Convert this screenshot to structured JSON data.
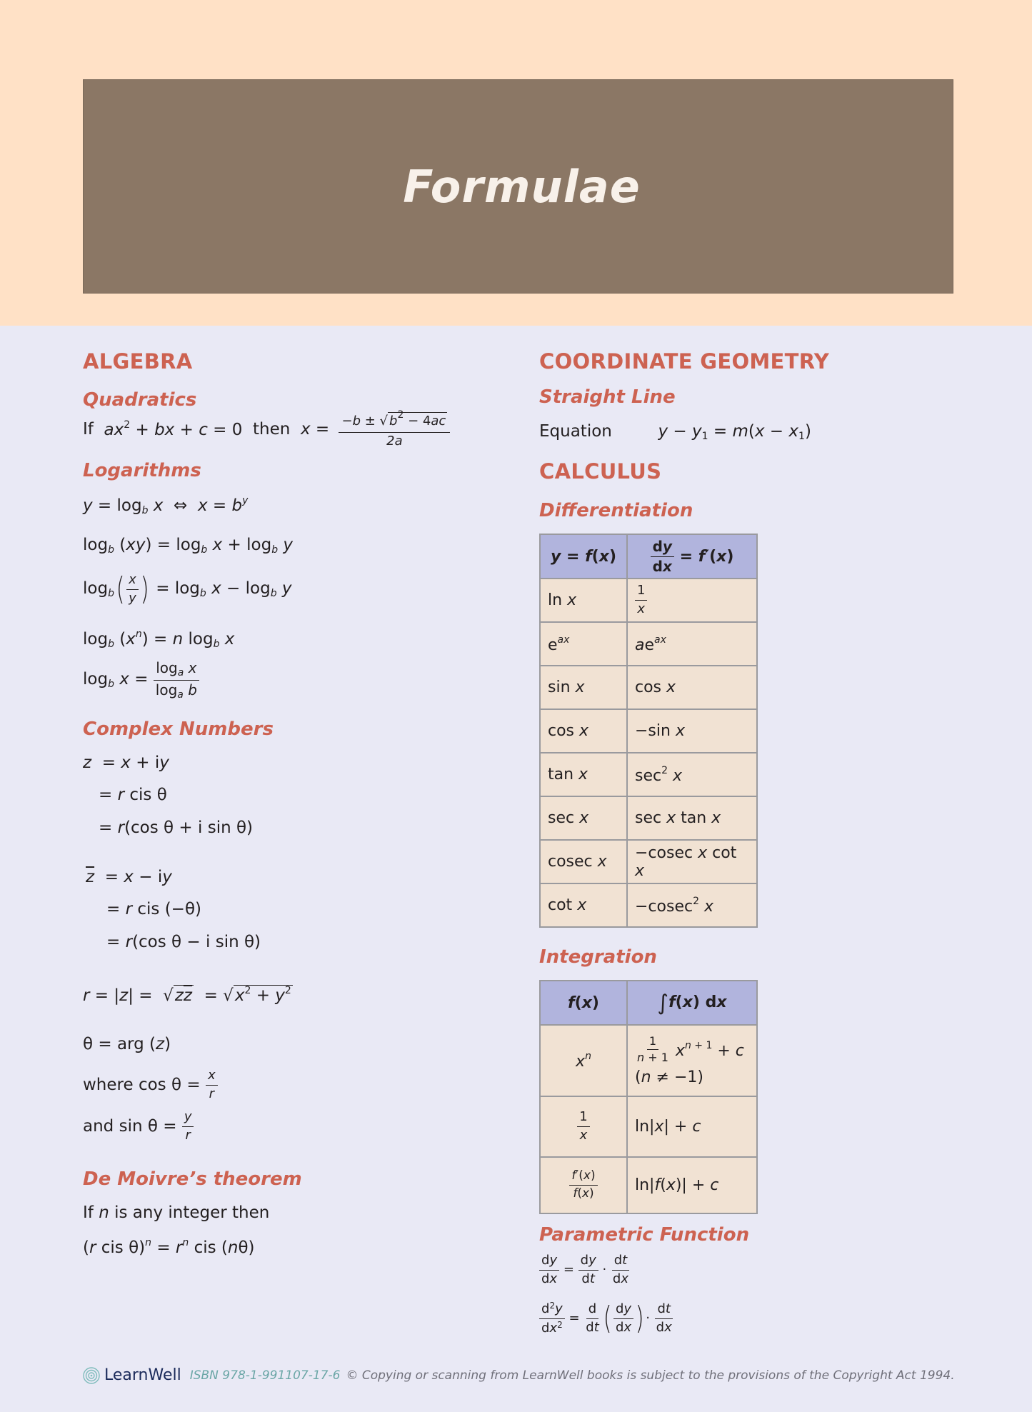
{
  "title": "Formulae",
  "colors": {
    "header_band": "#ffe1c6",
    "title_box": "#8b7765",
    "page_bg": "#e9e9f5",
    "heading": "#cd6251",
    "table_header": "#b1b4dd",
    "table_cell": "#f1e2d3"
  },
  "algebra": {
    "heading": "ALGEBRA",
    "quadratics": {
      "heading": "Quadratics",
      "if": "If",
      "lhs": "ax² + bx + c = 0",
      "then": "then",
      "x_eq": "x =",
      "numerator": "−b ± √(b² − 4ac)",
      "num_pre": "−b ±",
      "num_rad": "b² − 4ac",
      "denominator": "2a"
    },
    "logarithms": {
      "heading": "Logarithms",
      "formulas": [
        "y = log_b x ⇔ x = b^y",
        "log_b (xy) = log_b x + log_b y",
        "log_b (x/y) = log_b x − log_b y",
        "log_b (xⁿ) = n log_b x",
        "log_b x = log_a x / log_a b"
      ]
    },
    "complex": {
      "heading": "Complex Numbers",
      "lines": [
        "z = x + iy",
        "= r cis θ",
        "= r(cos θ + i sin θ)",
        "z̄ = x − iy",
        "= r cis (−θ)",
        "= r(cos θ − i sin θ)",
        "r = |z| = √(z z̄) = √(x² + y²)",
        "θ = arg (z)",
        "where cos θ = x/r",
        "and sin θ = y/r"
      ]
    },
    "demoivre": {
      "heading": "De Moivre’s theorem",
      "line1": "If n is any integer then",
      "line2": "(r cis θ)ⁿ = rⁿ cis (nθ)"
    }
  },
  "coordinate_geometry": {
    "heading": "COORDINATE GEOMETRY",
    "straight_line": {
      "heading": "Straight Line",
      "label": "Equation",
      "formula": "y − y₁ = m(x − x₁)"
    }
  },
  "calculus": {
    "heading": "CALCULUS",
    "differentiation": {
      "heading": "Differentiation",
      "columns": [
        "y = f(x)",
        "dy/dx = f′(x)"
      ],
      "rows": [
        [
          "ln x",
          "1/x"
        ],
        [
          "e^(ax)",
          "a e^(ax)"
        ],
        [
          "sin x",
          "cos x"
        ],
        [
          "cos x",
          "−sin x"
        ],
        [
          "tan x",
          "sec² x"
        ],
        [
          "sec x",
          "sec x tan x"
        ],
        [
          "cosec x",
          "−cosec x cot x"
        ],
        [
          "cot x",
          "−cosec² x"
        ]
      ]
    },
    "integration": {
      "heading": "Integration",
      "columns": [
        "f(x)",
        "∫ f(x) dx"
      ],
      "rows": [
        [
          "xⁿ",
          "1/(n+1) xⁿ⁺¹ + c (n ≠ −1)"
        ],
        [
          "1/x",
          "ln|x| + c"
        ],
        [
          "f′(x)/f(x)",
          "ln|f(x)| + c"
        ]
      ]
    },
    "parametric": {
      "heading": "Parametric Function",
      "formulas": [
        "dy/dx = dy/dt · dt/dx",
        "d²y/dx² = d/dt (dy/dx) · dt/dx"
      ]
    }
  },
  "footer": {
    "logo_icon": "spiral-logo-icon",
    "brand": "LearnWell",
    "isbn": "ISBN 978-1-991107-17-6",
    "copyright": "© Copying or scanning from LearnWell books is subject to the provisions of the Copyright Act 1994."
  }
}
